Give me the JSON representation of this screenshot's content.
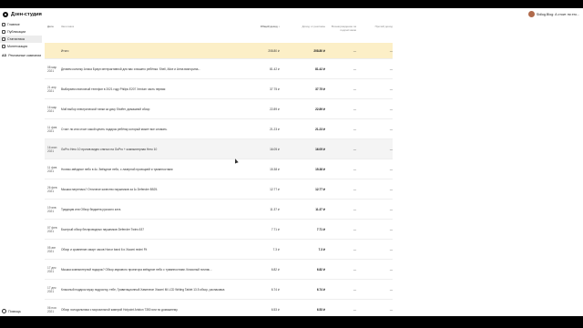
{
  "app": {
    "title": "Дзен-студия"
  },
  "channel": {
    "name": "Sidlog.Blog: А стоит ли это..."
  },
  "sidebar": {
    "items": [
      {
        "label": "Главное",
        "icon": "home-icon"
      },
      {
        "label": "Публикации",
        "icon": "document-icon"
      },
      {
        "label": "Статистика",
        "icon": "chart-icon",
        "active": true
      },
      {
        "label": "Монетизация",
        "icon": "coin-icon"
      },
      {
        "label": "Рекламные кампании",
        "icon": "ad-icon",
        "icon_text": "AD"
      }
    ],
    "help": "Помощь"
  },
  "table": {
    "headers": {
      "date": "Дата",
      "title": "Заголовок",
      "total": "Общий доход ↓",
      "subs": "Доход от рекламы",
      "interactions": "Вознаграждение за подписчиков",
      "other": "Прочий доход"
    },
    "total_row": {
      "title": "Итого",
      "total": "208.80 ₽",
      "subs": "208.80 ₽",
      "interactions": "—",
      "other": "—"
    },
    "rows": [
      {
        "date": "08 мар 2021",
        "title": "Делаем колонку Алиса Браун интерактивной для вас и вашего ребёнка. Shell, Alice и Анна викторина...",
        "total": "81.42 ₽",
        "subs": "81.42 ₽",
        "interactions": "—",
        "other": "—"
      },
      {
        "date": "21 апр 2021",
        "title": "Выбираем кнопочный телефон в 2021 году Philips E207 Xenium часть первая",
        "total": "37.75 ₽",
        "subs": "37.75 ₽",
        "interactions": "—",
        "other": "—"
      },
      {
        "date": "16 мар 2021",
        "title": "Мой выбор электрической тапки за дачу Shoffer, домашний обзор",
        "total": "22.89 ₽",
        "subs": "22.89 ₽",
        "interactions": "—",
        "other": "—"
      },
      {
        "date": "11 фев 2021",
        "title": "Стоит ли или стоит какой купить подарок ребёнку который может все сломать.",
        "total": "21.23 ₽",
        "subs": "21.23 ₽",
        "interactions": "—",
        "other": "—"
      },
      {
        "date": "16 июн 2021",
        "title": "GoPro Hero 10 против видео снятых на GoPro + компьютерная Hero 10",
        "total": "16.05 ₽",
        "subs": "16.05 ₽",
        "interactions": "—",
        "other": "—"
      },
      {
        "date": "11 фев 2021",
        "title": "Ночник звёздное небо в 4к. Звёздное небо, с лазерной проекцией и туманностями",
        "total": "15.38 ₽",
        "subs": "15.38 ₽",
        "interactions": "—",
        "other": "—"
      },
      {
        "date": "26 фев 2021",
        "title": "Мышка нагрелась? Отличное качество наушников за 1к Defender B525.",
        "total": "12.77 ₽",
        "subs": "12.77 ₽",
        "interactions": "—",
        "other": "—"
      },
      {
        "date": "19 янв 2021",
        "title": "Традиция или Обзор бюджета русского кота.",
        "total": "11.37 ₽",
        "subs": "11.37 ₽",
        "interactions": "—",
        "other": "—"
      },
      {
        "date": "07 фев 2021",
        "title": "Быстрый обзор беспроводных наушников Defender Twins 637",
        "total": "7.71 ₽",
        "subs": "7.71 ₽",
        "interactions": "—",
        "other": "—"
      },
      {
        "date": "05 авг 2021",
        "title": "Обзор и сравнение смарт часов Honor band 6 и Xiaomi redmi Fit",
        "total": "7.3 ₽",
        "subs": "7.3 ₽",
        "interactions": "—",
        "other": "—"
      },
      {
        "date": "17 дек 2021",
        "title": "Мышка компьютерной подарок? Обзор звукового проектора звёздное небо с туманностями. Классный ночник...",
        "total": "6.82 ₽",
        "subs": "6.82 ₽",
        "interactions": "—",
        "other": "—"
      },
      {
        "date": "17 дек 2021",
        "title": "Классный подарок мужу подростку, тебе, Гравитационный Хамелеон Xiaomi Mi LCD Writing Tablet 13.5 обзор, распаковка",
        "total": "6.74 ₽",
        "subs": "6.74 ₽",
        "interactions": "—",
        "other": "—"
      },
      {
        "date": "06 ноя 2021",
        "title": "Обзор холодильника с морозильной камерой Hotpoint Ariston 7350 или по домашнему.",
        "total": "6.53 ₽",
        "subs": "6.53 ₽",
        "interactions": "—",
        "other": "—"
      }
    ]
  }
}
